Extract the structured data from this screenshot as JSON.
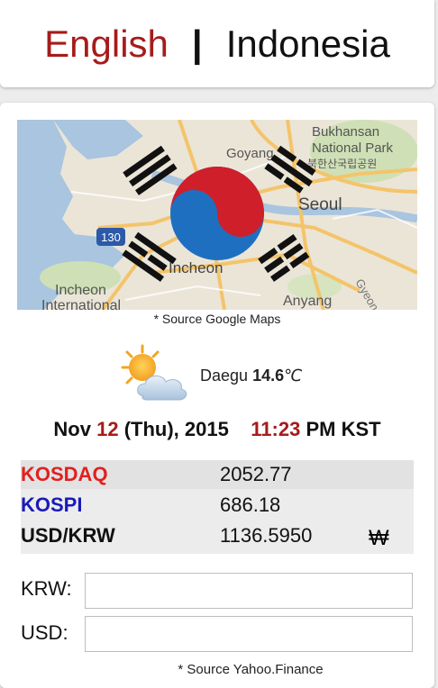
{
  "languages": {
    "english": "English",
    "separator": "|",
    "indonesia": "Indonesia"
  },
  "map": {
    "source_note": "* Source Google Maps",
    "place_labels": [
      "Bukhansan",
      "National Park",
      "북한산국립공원",
      "Goyang",
      "Seoul",
      "Incheon",
      "Incheon",
      "International",
      "Anyang",
      "Gyeonggi",
      "130"
    ]
  },
  "weather": {
    "city": "Daegu",
    "temperature": "14.6",
    "unit": "℃",
    "icon": "partly-cloudy-icon"
  },
  "datetime": {
    "month": "Nov",
    "day": "12",
    "weekday_open": "(Thu), 2015",
    "hour_minute": "11:23",
    "suffix": "PM KST"
  },
  "market": {
    "rows": [
      {
        "name": "KOSDAQ",
        "value": "2052.77",
        "color": "#e02020"
      },
      {
        "name": "KOSPI",
        "value": "686.18",
        "color": "#1a1ab8"
      },
      {
        "name": "USD/KRW",
        "value": "1136.5950",
        "color": "#111111",
        "currency": "₩"
      }
    ]
  },
  "converter": {
    "krw_label": "KRW:",
    "usd_label": "USD:",
    "krw_value": "",
    "usd_value": "",
    "source_note": "* Source Yahoo.Finance"
  },
  "colors": {
    "accent_red": "#a61b1b",
    "kosdaq_red": "#e02020",
    "kospi_blue": "#1a1ab8"
  }
}
